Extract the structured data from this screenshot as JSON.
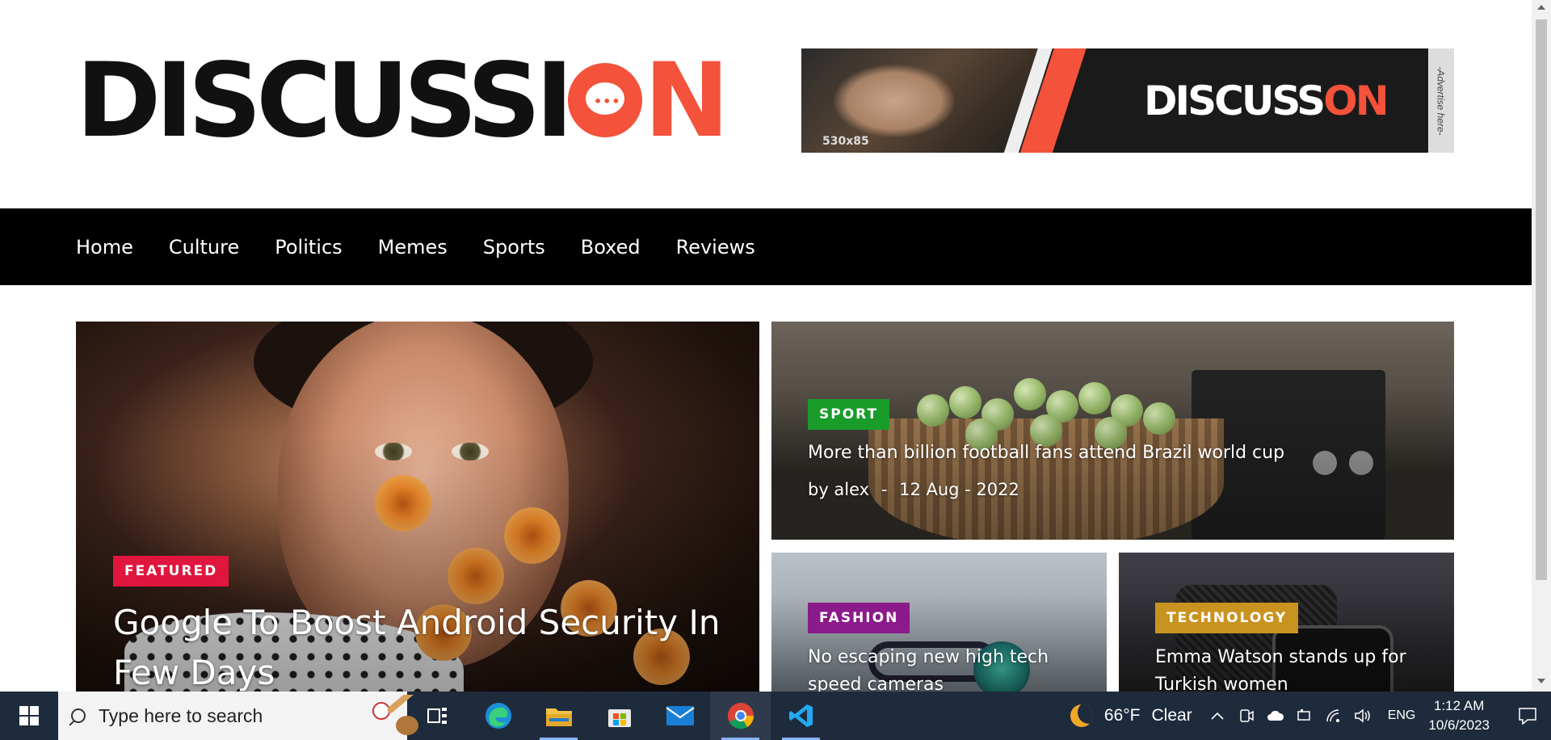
{
  "site": {
    "logo_text": "DISCUSSI",
    "logo_accent": "N",
    "logo_bubble_dots": "•••",
    "brand_color": "#f4523b"
  },
  "ad": {
    "size_label": "530x85",
    "logo_text": "DISCUSS",
    "logo_accent": "ON",
    "side_label": "-Advertise here-"
  },
  "nav": {
    "items": [
      "Home",
      "Culture",
      "Politics",
      "Memes",
      "Sports",
      "Boxed",
      "Reviews"
    ]
  },
  "cards": {
    "featured": {
      "tag": "FEATURED",
      "tag_color": "#e0163e",
      "title": "Google To Boost Android Security In Few Days"
    },
    "sport": {
      "tag": "SPORT",
      "tag_color": "#1a9c2b",
      "title": "More than billion football fans attend Brazil world cup",
      "author": "by alex",
      "separator": "-",
      "date": "12 Aug - 2022"
    },
    "fashion": {
      "tag": "FASHION",
      "tag_color": "#8b1a8b",
      "title": "No escaping new high tech speed cameras"
    },
    "technology": {
      "tag": "TECHNOLOGY",
      "tag_color": "#c99320",
      "title": "Emma Watson stands up for Turkish women"
    }
  },
  "taskbar": {
    "search_placeholder": "Type here to search",
    "apps": [
      "task-view-icon",
      "edge-icon",
      "file-explorer-icon",
      "microsoft-store-icon",
      "mail-icon",
      "chrome-icon",
      "vscode-icon"
    ],
    "weather": {
      "temp": "66°F",
      "condition": "Clear"
    },
    "language": "ENG",
    "time": "1:12 AM",
    "date": "10/6/2023"
  }
}
